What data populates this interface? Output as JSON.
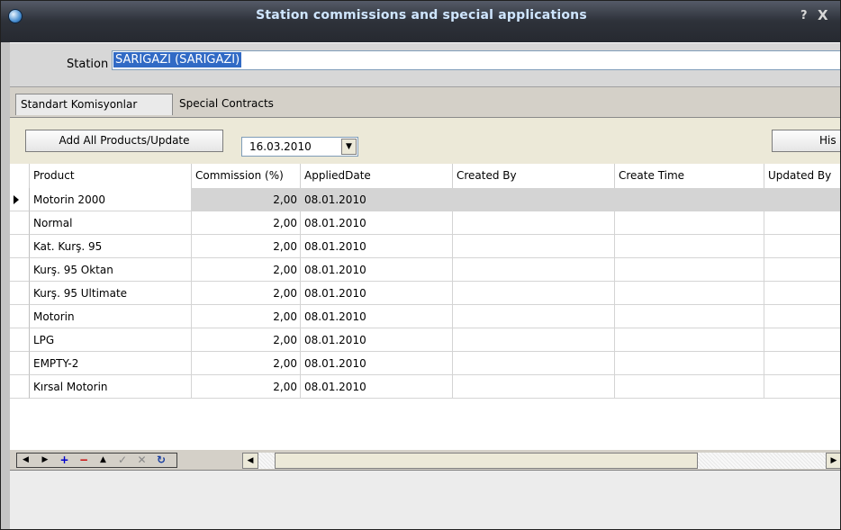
{
  "window": {
    "title": "Station commissions and special applications",
    "help_label": "?",
    "close_label": "X"
  },
  "station": {
    "label": "Station",
    "value": "SARIGAZI (SARIGAZI)"
  },
  "tabs": [
    {
      "label": "Standart Komisyonlar",
      "active": true
    },
    {
      "label": "Special Contracts",
      "active": false
    }
  ],
  "toolbar": {
    "add_all_label": "Add All Products/Update",
    "date_value": "16.03.2010",
    "history_label": "His"
  },
  "grid": {
    "columns": [
      "Product",
      "Commission (%)",
      "AppliedDate",
      "Created By",
      "Create Time",
      "Updated By"
    ],
    "rows": [
      {
        "product": "Motorin 2000",
        "commission": "2,00",
        "applied": "08.01.2010",
        "created_by": "",
        "create_time": "",
        "updated_by": ""
      },
      {
        "product": "Normal",
        "commission": "2,00",
        "applied": "08.01.2010",
        "created_by": "",
        "create_time": "",
        "updated_by": ""
      },
      {
        "product": "Kat. Kurş. 95",
        "commission": "2,00",
        "applied": "08.01.2010",
        "created_by": "",
        "create_time": "",
        "updated_by": ""
      },
      {
        "product": "Kurş. 95 Oktan",
        "commission": "2,00",
        "applied": "08.01.2010",
        "created_by": "",
        "create_time": "",
        "updated_by": ""
      },
      {
        "product": "Kurş. 95 Ultimate",
        "commission": "2,00",
        "applied": "08.01.2010",
        "created_by": "",
        "create_time": "",
        "updated_by": ""
      },
      {
        "product": "Motorin",
        "commission": "2,00",
        "applied": "08.01.2010",
        "created_by": "",
        "create_time": "",
        "updated_by": ""
      },
      {
        "product": "LPG",
        "commission": "2,00",
        "applied": "08.01.2010",
        "created_by": "",
        "create_time": "",
        "updated_by": ""
      },
      {
        "product": "EMPTY-2",
        "commission": "2,00",
        "applied": "08.01.2010",
        "created_by": "",
        "create_time": "",
        "updated_by": ""
      },
      {
        "product": "Kırsal Motorin",
        "commission": "2,00",
        "applied": "08.01.2010",
        "created_by": "",
        "create_time": "",
        "updated_by": ""
      }
    ]
  },
  "navigator": {
    "buttons": [
      {
        "name": "nav-prior-icon",
        "glyph": "◀"
      },
      {
        "name": "nav-next-icon",
        "glyph": "▶"
      },
      {
        "name": "nav-insert-icon",
        "glyph": "+"
      },
      {
        "name": "nav-delete-icon",
        "glyph": "−"
      },
      {
        "name": "nav-edit-icon",
        "glyph": "▲"
      },
      {
        "name": "nav-post-icon",
        "glyph": "✓"
      },
      {
        "name": "nav-cancel-icon",
        "glyph": "✕"
      },
      {
        "name": "nav-refresh-icon",
        "glyph": "↻"
      }
    ],
    "scroll_left": "◀",
    "scroll_right": "▶"
  },
  "colors": {
    "title_text": "#cfe6ff",
    "selection": "#316ac5",
    "nav_insert": "#0000cc",
    "nav_delete": "#cc0000"
  }
}
